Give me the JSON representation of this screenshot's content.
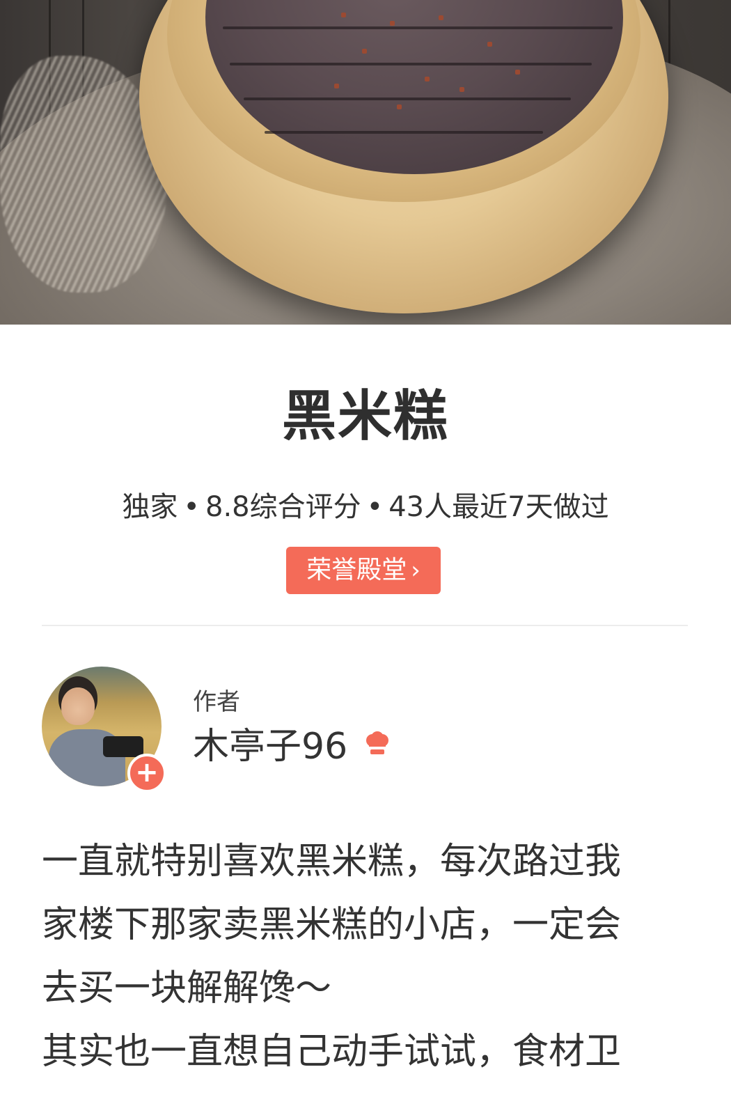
{
  "recipe": {
    "title": "黑米糕",
    "meta": {
      "tag": "独家",
      "rating": "8.8综合评分",
      "recent": "43人最近7天做过"
    },
    "honor_button": "荣誉殿堂",
    "hero_image": "steamed-black-rice-cake-photo"
  },
  "author": {
    "label": "作者",
    "name": "木亭子96",
    "follow_icon": "plus-icon",
    "badge_icon": "chef-hat-icon"
  },
  "description": {
    "lines": [
      "一直就特别喜欢黑米糕，每次路过我",
      "家楼下那家卖黑米糕的小店，一定会",
      "去买一块解解馋～",
      "其实也一直想自己动手试试，食材卫"
    ]
  },
  "colors": {
    "accent": "#f46b58",
    "title": "#2f2f2f",
    "text": "#333333",
    "divider": "#ececec"
  }
}
